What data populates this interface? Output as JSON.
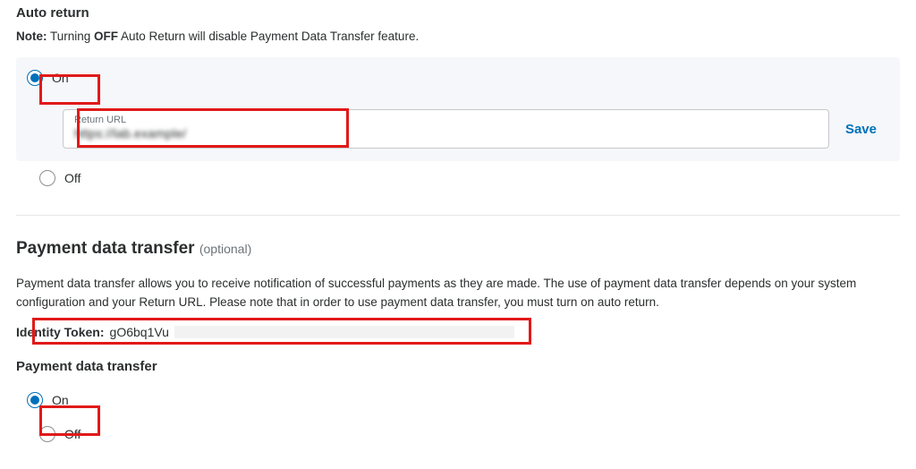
{
  "auto_return": {
    "heading": "Auto return",
    "note_label": "Note:",
    "note_prefix": " Turning ",
    "note_bold": "OFF",
    "note_suffix": " Auto Return will disable Payment Data Transfer feature.",
    "on_label": "On",
    "off_label": "Off",
    "return_url_label": "Return URL",
    "return_url_value": "https://lab.example/",
    "save_label": "Save"
  },
  "pdt": {
    "heading": "Payment data transfer",
    "optional": "(optional)",
    "description": "Payment data transfer allows you to receive notification of successful payments as they are made. The use of payment data transfer depends on your system configuration and your Return URL. Please note that in order to use payment data transfer, you must turn on auto return.",
    "token_label": "Identity Token:",
    "token_value": "gO6bq1Vu",
    "sub_heading": "Payment data transfer",
    "on_label": "On",
    "off_label": "Off"
  }
}
